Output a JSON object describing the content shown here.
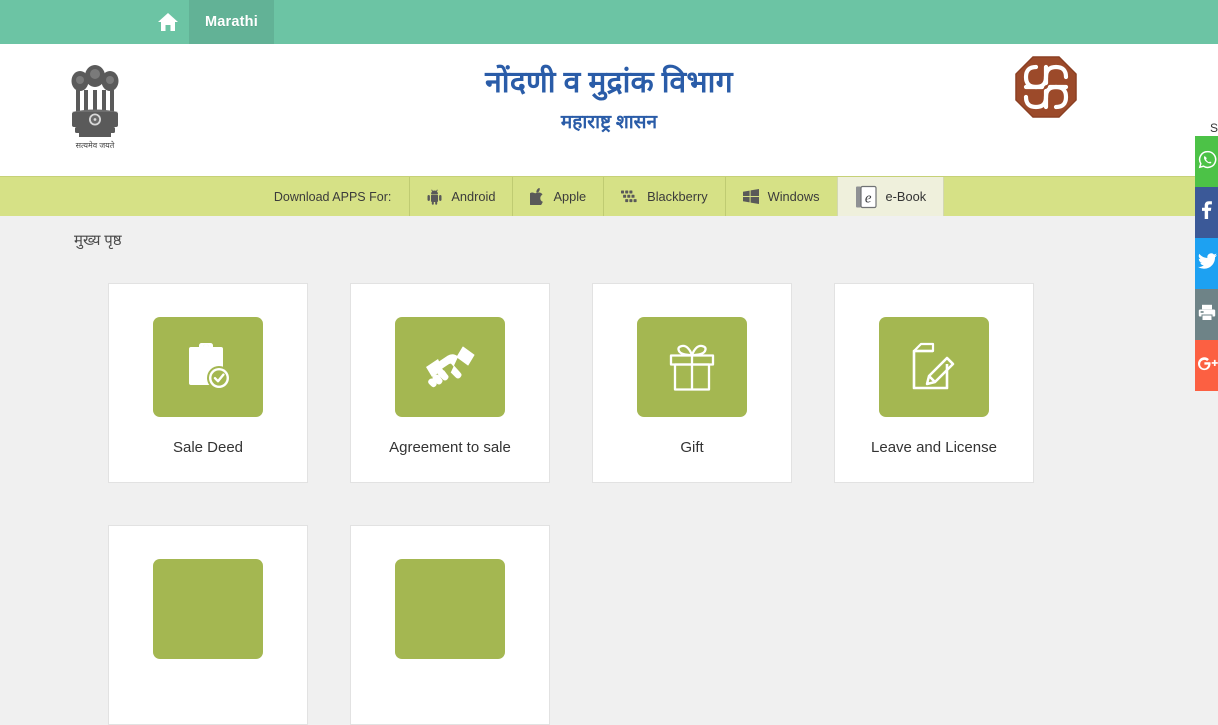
{
  "topbar": {
    "home_icon": "home-icon",
    "language_label": "Marathi"
  },
  "header": {
    "emblem_icon": "india-state-emblem-icon",
    "emblem_motto": "सत्यमेव जयते",
    "title": "नोंदणी व मुद्रांक विभाग",
    "subtitle": "महाराष्ट्र शासन",
    "dept_logo_icon": "igr-maharashtra-logo-icon"
  },
  "apps_bar": {
    "label": "Download APPS For:",
    "items": [
      {
        "label": "Android",
        "icon": "android-icon",
        "active": false
      },
      {
        "label": "Apple",
        "icon": "apple-icon",
        "active": false
      },
      {
        "label": "Blackberry",
        "icon": "blackberry-icon",
        "active": false
      },
      {
        "label": "Windows",
        "icon": "windows-icon",
        "active": false
      },
      {
        "label": "e-Book",
        "icon": "ebook-icon",
        "active": true
      }
    ]
  },
  "breadcrumb": {
    "text": "मुख्य पृष्ठ"
  },
  "cards": [
    {
      "label": "Sale Deed",
      "icon": "clipboard-check-icon"
    },
    {
      "label": "Agreement to sale",
      "icon": "handshake-icon"
    },
    {
      "label": "Gift",
      "icon": "gift-box-icon"
    },
    {
      "label": "Leave and License",
      "icon": "document-pencil-icon"
    },
    {
      "label": "",
      "icon": "placeholder-icon"
    },
    {
      "label": "",
      "icon": "placeholder-icon"
    }
  ],
  "social": {
    "label": "S",
    "items": [
      {
        "name": "whatsapp",
        "icon": "whatsapp-icon",
        "color": "#4cc247"
      },
      {
        "name": "facebook",
        "icon": "facebook-icon",
        "color": "#3b5998"
      },
      {
        "name": "twitter",
        "icon": "twitter-icon",
        "color": "#1da1f2"
      },
      {
        "name": "print",
        "icon": "print-icon",
        "color": "#6e8387"
      },
      {
        "name": "google-plus",
        "icon": "google-plus-icon",
        "color": "#fc6042"
      }
    ]
  },
  "colors": {
    "topbar_teal": "#6cc4a4",
    "lang_tab_teal": "#62b296",
    "apps_bar_green": "#d6e186",
    "tile_green": "#a4b751",
    "title_blue": "#2a5ca8",
    "page_bg": "#f0f0f0",
    "logo_brown": "#9c4a2a"
  }
}
